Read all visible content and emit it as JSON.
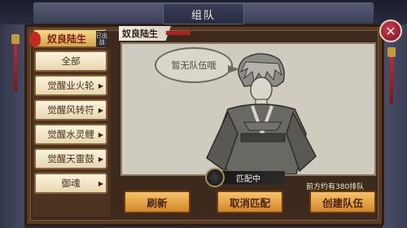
{
  "header": {
    "title": "组队"
  },
  "character": {
    "name": "奴良陆生",
    "tag": "已出战"
  },
  "menu": {
    "items": [
      {
        "label": "全部",
        "has_arrow": false
      },
      {
        "label": "觉醒业火轮",
        "has_arrow": true
      },
      {
        "label": "觉醒风转符",
        "has_arrow": true
      },
      {
        "label": "觉醒水灵鲤",
        "has_arrow": true
      },
      {
        "label": "觉醒天雷鼓",
        "has_arrow": true
      },
      {
        "label": "御魂",
        "has_arrow": true
      }
    ]
  },
  "team": {
    "leader_name": "奴良陆生",
    "empty_message": "暂无队伍哦"
  },
  "matching": {
    "status": "匹配中",
    "queue_text": "前方约有380排队"
  },
  "buttons": {
    "refresh": "刷新",
    "cancel_match": "取消匹配",
    "create_team": "创建队伍"
  },
  "colors": {
    "button_accent": "#d3862b",
    "close_button": "#c9384a",
    "tassel": "#c8292a"
  }
}
